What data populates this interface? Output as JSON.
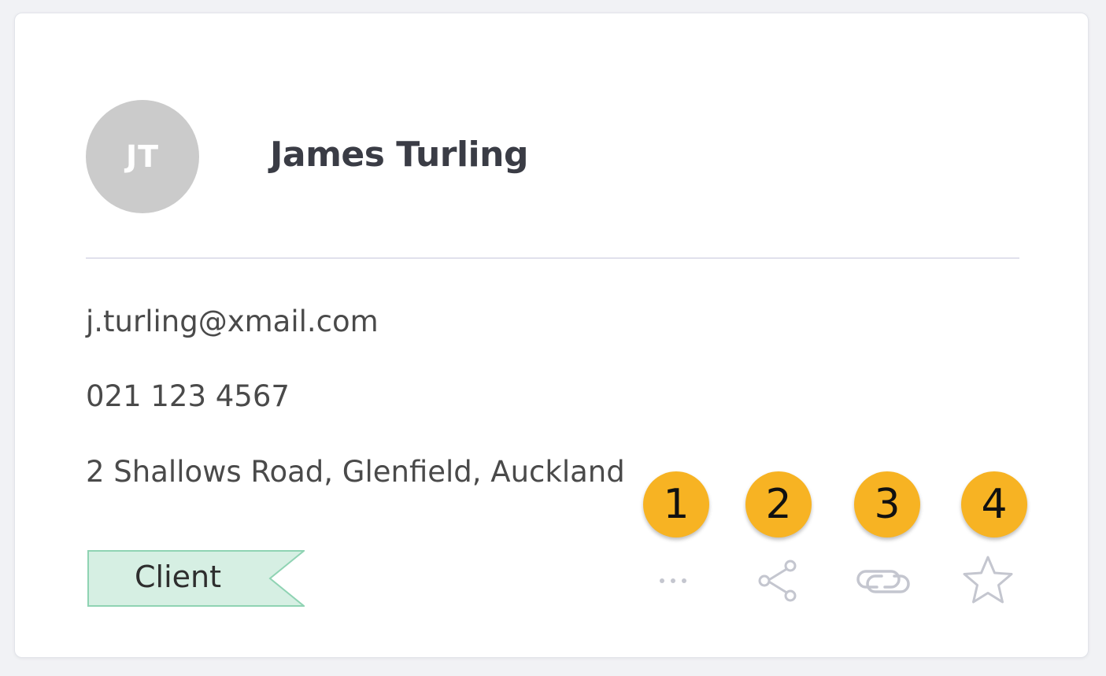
{
  "contact": {
    "initials": "JT",
    "name": "James Turling",
    "email": "j.turling@xmail.com",
    "phone": "021 123 4567",
    "address": "2 Shallows Road, Glenfield, Auckland",
    "tag": "Client"
  },
  "actions": [
    {
      "name": "more-options",
      "icon": "ellipsis-icon"
    },
    {
      "name": "share",
      "icon": "share-icon"
    },
    {
      "name": "link",
      "icon": "link-icon"
    },
    {
      "name": "favourite",
      "icon": "star-icon"
    }
  ],
  "badges": [
    "1",
    "2",
    "3",
    "4"
  ],
  "colors": {
    "avatar_bg": "#cbcbcb",
    "tag_bg": "#d6efe3",
    "tag_border": "#8fd3b3",
    "badge_bg": "#f7b323",
    "icon": "#c4c6cf"
  }
}
